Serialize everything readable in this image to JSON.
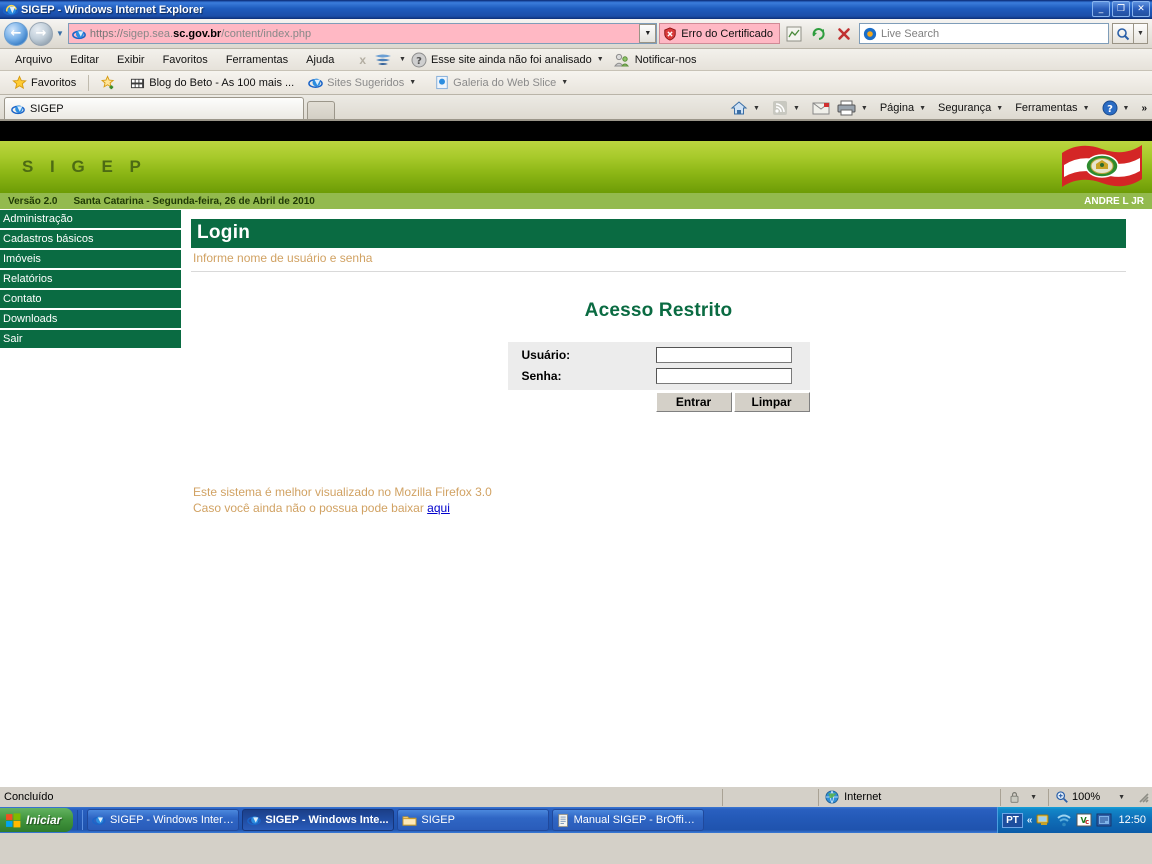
{
  "window": {
    "title": "SIGEP - Windows Internet Explorer",
    "minimize": "_",
    "restore": "❐",
    "close": "✕"
  },
  "navbar": {
    "back_icon": "back-arrow-icon",
    "forward_icon": "forward-arrow-icon",
    "url_protocol": "https://",
    "url_host_pre": "sigep.sea.",
    "url_host_bold": "sc.gov.br",
    "url_path": "/content/index.php",
    "cert_error": "Erro do Certificado",
    "search_placeholder": "Live Search"
  },
  "menu": {
    "items": [
      "Arquivo",
      "Editar",
      "Exibir",
      "Favoritos",
      "Ferramentas",
      "Ajuda"
    ],
    "close_x": "x",
    "smartscreen": "Esse site ainda não foi analisado",
    "notify": "Notificar-nos"
  },
  "favbar": {
    "favorites": "Favoritos",
    "items": [
      {
        "label": "Blog do Beto - As 100 mais ...",
        "dim": false,
        "caret": false
      },
      {
        "label": "Sites Sugeridos",
        "dim": true,
        "caret": true
      },
      {
        "label": "Galeria do Web Slice",
        "dim": true,
        "caret": true
      }
    ]
  },
  "tabs": {
    "items": [
      {
        "label": "SIGEP"
      }
    ],
    "commands": [
      {
        "label": "Página",
        "caret": true
      },
      {
        "label": "Segurança",
        "caret": true
      },
      {
        "label": "Ferramentas",
        "caret": true
      }
    ],
    "overflow": "»"
  },
  "site": {
    "logo": "S I G E P",
    "version": "Versão 2.0",
    "location_date": "Santa Catarina - Segunda-feira, 26 de Abril de 2010",
    "user": "ANDRE L JR",
    "sidebar": [
      "Administração",
      "Cadastros básicos",
      "Imóveis",
      "Relatórios",
      "Contato",
      "Downloads",
      "Sair"
    ],
    "page_title": "Login",
    "page_subtitle": "Informe nome de usuário e senha",
    "form_heading": "Acesso Restrito",
    "fields": [
      {
        "label": "Usuário:",
        "value": ""
      },
      {
        "label": "Senha:",
        "value": ""
      }
    ],
    "submit_label": "Entrar",
    "clear_label": "Limpar",
    "notice_line1": "Este sistema é melhor visualizado no Mozilla Firefox 3.0",
    "notice_line2_pre": "Caso você ainda não o possua pode baixar ",
    "notice_link": "aqui",
    "colors": {
      "green_dark": "#0a6b42",
      "green_light": "#bcd53f",
      "tan": "#d1a263",
      "link": "#0000cc"
    }
  },
  "statusbar": {
    "status": "Concluído",
    "zone": "Internet",
    "zoom": "100%"
  },
  "taskbar": {
    "start": "Iniciar",
    "items": [
      {
        "label": "SIGEP - Windows Intern...",
        "icon": "ie-icon",
        "active": false
      },
      {
        "label": "SIGEP - Windows Inte...",
        "icon": "ie-icon",
        "active": true
      },
      {
        "label": "SIGEP",
        "icon": "folder-icon",
        "active": false
      },
      {
        "label": "Manual SIGEP - BrOffice....",
        "icon": "document-icon",
        "active": false
      }
    ],
    "lang": "PT",
    "chevrons": "«",
    "clock": "12:50"
  }
}
